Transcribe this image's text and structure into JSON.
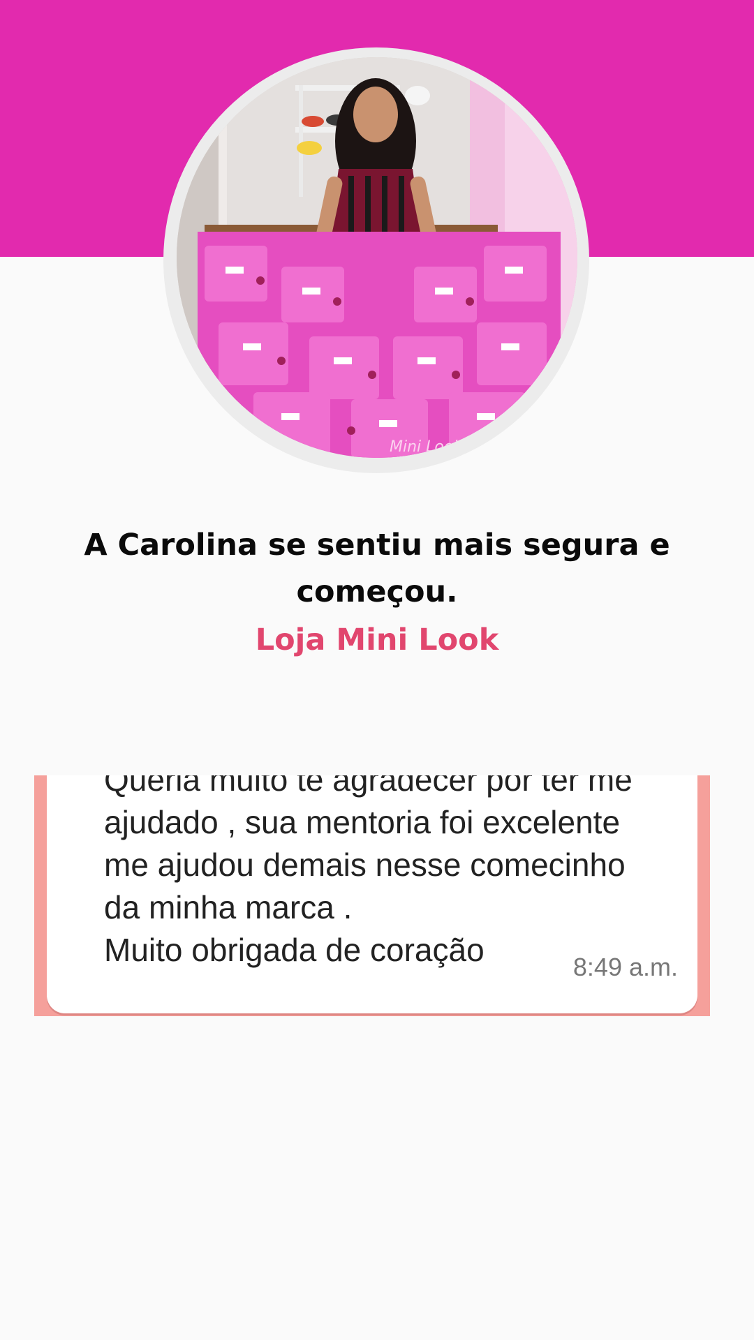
{
  "testimonial": {
    "headline": "A Carolina se sentiu mais segura e começou.",
    "brand_name": "Loja Mini Look"
  },
  "photo": {
    "icon": "testimonial-photo",
    "bag_print": "Mini Look"
  },
  "chat_message": {
    "text": "Queria muito te agradecer por ter me\najudado , sua mentoria foi excelente\nme ajudou demais nesse comecinho\nda minha marca .\nMuito obrigada de coração",
    "time": "8:49 a.m."
  },
  "colors": {
    "header_band": "#e22aae",
    "brand_text": "#e1466e",
    "chat_frame": "#f5a09b"
  }
}
